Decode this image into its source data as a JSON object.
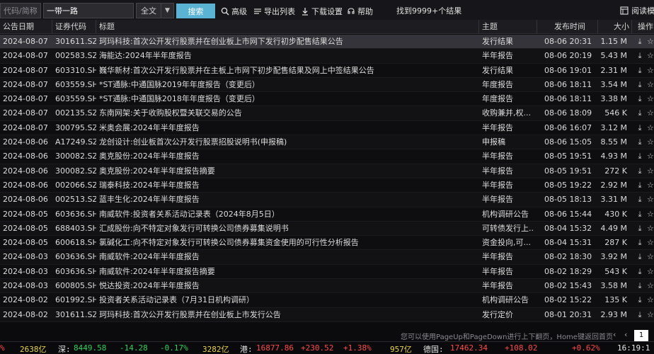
{
  "toolbar": {
    "code_placeholder": "代码/简称",
    "keyword_value": "一带一路",
    "scope_select": "全文",
    "search_label": "搜索",
    "advanced_label": "高级",
    "export_label": "导出列表",
    "download_settings_label": "下载设置",
    "help_label": "帮助",
    "result_count": "找到9999+个结果",
    "read_mode_label": "阅读模"
  },
  "table": {
    "headers": {
      "date": "公告日期",
      "code": "证券代码",
      "title": "标题",
      "topic": "主题",
      "time": "发布时间",
      "size": "大小",
      "ops": "操作"
    },
    "rows": [
      {
        "date": "2024-08-07",
        "code": "301611.SZ",
        "title": "珂玛科技:首次公开发行股票并在创业板上市网下发行初步配售结果公告",
        "topic": "发行结果",
        "time": "08-06 20:31",
        "size": "1.15 M"
      },
      {
        "date": "2024-08-07",
        "code": "002583.SZ",
        "title": "海能达:2024年半年度报告",
        "topic": "半年报告",
        "time": "08-06 20:19",
        "size": "5.43 M"
      },
      {
        "date": "2024-08-07",
        "code": "603310.SH",
        "title": "巍华新材:首次公开发行股票并在主板上市网下初步配售结果及网上中签结果公告",
        "topic": "发行结果",
        "time": "08-06 19:01",
        "size": "2.31 M"
      },
      {
        "date": "2024-08-07",
        "code": "603559.SH",
        "title": "*ST通脉:中通国脉2019年年度报告（变更后）",
        "topic": "年度报告",
        "time": "08-06 18:11",
        "size": "3.54 M"
      },
      {
        "date": "2024-08-07",
        "code": "603559.SH",
        "title": "*ST通脉:中通国脉2018年年度报告（变更后）",
        "topic": "年度报告",
        "time": "08-06 18:11",
        "size": "3.38 M"
      },
      {
        "date": "2024-08-07",
        "code": "002135.SZ",
        "title": "东南网架:关于收购股权暨关联交易的公告",
        "topic": "收购兼并,权...",
        "time": "08-06 18:09",
        "size": "546 K"
      },
      {
        "date": "2024-08-07",
        "code": "300795.SZ",
        "title": "米奥会展:2024年半年度报告",
        "topic": "半年报告",
        "time": "08-06 16:07",
        "size": "3.12 M"
      },
      {
        "date": "2024-08-06",
        "code": "A17249.SZ",
        "title": "龙创设计:创业板首次公开发行股票招股说明书(申报稿)",
        "topic": "申报稿",
        "time": "08-06 15:05",
        "size": "8.55 M"
      },
      {
        "date": "2024-08-06",
        "code": "300082.SZ",
        "title": "奥克股份:2024年半年度报告",
        "topic": "半年报告",
        "time": "08-05 19:51",
        "size": "4.93 M"
      },
      {
        "date": "2024-08-06",
        "code": "300082.SZ",
        "title": "奥克股份:2024年半年度报告摘要",
        "topic": "半年报告",
        "time": "08-05 19:51",
        "size": "272 K"
      },
      {
        "date": "2024-08-06",
        "code": "002066.SZ",
        "title": "瑞泰科技:2024年半年度报告",
        "topic": "半年报告",
        "time": "08-05 19:22",
        "size": "2.92 M"
      },
      {
        "date": "2024-08-06",
        "code": "002513.SZ",
        "title": "蓝丰生化:2024年半年度报告",
        "topic": "半年报告",
        "time": "08-05 18:13",
        "size": "3.31 M"
      },
      {
        "date": "2024-08-05",
        "code": "603636.SH",
        "title": "南威软件:投资者关系活动记录表（2024年8月5日）",
        "topic": "机构调研公告",
        "time": "08-06 15:44",
        "size": "430 K"
      },
      {
        "date": "2024-08-05",
        "code": "688403.SH",
        "title": "汇成股份:向不特定对象发行可转换公司债券募集说明书",
        "topic": "可转债发行上...",
        "time": "08-04 15:32",
        "size": "4.49 M"
      },
      {
        "date": "2024-08-05",
        "code": "600618.SH",
        "title": "氯碱化工:向不特定对象发行可转换公司债券募集资金使用的可行性分析报告",
        "topic": "资金投向,可...",
        "time": "08-04 15:31",
        "size": "287 K"
      },
      {
        "date": "2024-08-03",
        "code": "603636.SH",
        "title": "南威软件:2024年半年度报告",
        "topic": "半年报告",
        "time": "08-02 18:30",
        "size": "3.92 M"
      },
      {
        "date": "2024-08-03",
        "code": "603636.SH",
        "title": "南威软件:2024年半年度报告摘要",
        "topic": "半年报告",
        "time": "08-02 18:29",
        "size": "543 K"
      },
      {
        "date": "2024-08-03",
        "code": "600805.SH",
        "title": "悦达投资:2024年半年度报告",
        "topic": "半年报告",
        "time": "08-02 15:43",
        "size": "3.58 M"
      },
      {
        "date": "2024-08-02",
        "code": "601992.SH",
        "title": "投资者关系活动记录表（7月31日机构调研）",
        "topic": "机构调研公告",
        "time": "08-02 15:22",
        "size": "135 K"
      },
      {
        "date": "2024-08-02",
        "code": "301611.SZ",
        "title": "珂玛科技:首次公开发行股票并在创业板上市发行公告",
        "topic": "发行定价",
        "time": "08-01 20:31",
        "size": "2.93 M"
      }
    ]
  },
  "footer": {
    "hint": "您可以使用PageUp和PageDown进行上下翻页，Home键返回首页",
    "prev_symbol": "‹",
    "first_symbol": "‹",
    "page_number": "1"
  },
  "ticker": {
    "item0_change": "%",
    "item0_amount": "2638亿",
    "sz_label": "深:",
    "sz_index": "8449.58",
    "sz_change": "-14.28",
    "sz_pct": "-0.17%",
    "sz_amount": "3282亿",
    "hk_label": "港:",
    "hk_index": "16877.86",
    "hk_change": "+230.52",
    "hk_pct": "+1.38%",
    "hk_amount": "957亿",
    "de_label": "德国:",
    "de_index": "17462.34",
    "de_change": "+108.02",
    "de_pct": "+0.62%",
    "clock": "16:19:1"
  },
  "colors": {
    "accent": "#5bb3d4",
    "up": "#ff4a4a",
    "down": "#2fd15a",
    "amount": "#e8d34b",
    "selected_row": "#34343a"
  },
  "icons": [
    "search-icon",
    "export-list-icon",
    "download-icon",
    "help-icon",
    "read-mode-icon",
    "star-icon"
  ]
}
